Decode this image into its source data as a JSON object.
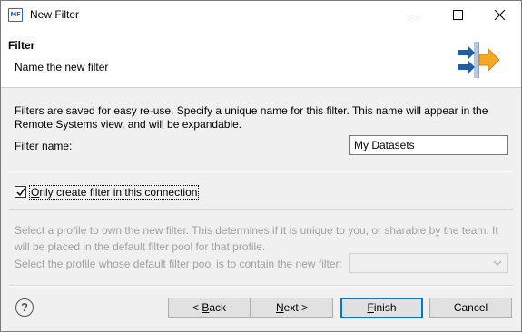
{
  "window": {
    "title": "New Filter",
    "app_icon_text": "MF"
  },
  "banner": {
    "title": "Filter",
    "message": "Name the new filter"
  },
  "form": {
    "description": "Filters are saved for easy re-use. Specify a unique name for this filter. This name will appear in the Remote Systems view, and will be expandable.",
    "filter_name_label_mnemonic": "F",
    "filter_name_label_rest": "ilter name:",
    "filter_name_value": "My Datasets",
    "checkbox_mnemonic": "O",
    "checkbox_label_rest": "nly create filter in this connection",
    "checkbox_checked": true,
    "profile_description": "Select a profile to own the new filter. This determines if it is unique to you, or sharable by the team. It will be placed in the default filter pool for that profile.",
    "profile_label": "Select the profile whose default filter pool is to contain the new filter:",
    "profile_value": ""
  },
  "footer": {
    "help_symbol": "?",
    "back_prefix": "< ",
    "back_mnemonic": "B",
    "back_rest": "ack",
    "next_mnemonic": "N",
    "next_rest": "ext >",
    "finish_mnemonic": "F",
    "finish_rest": "inish",
    "cancel_label": "Cancel"
  },
  "colors": {
    "accent": "#0078d7",
    "arrow_blue": "#1f5fa8",
    "arrow_orange": "#f5a623",
    "disabled_text": "#a0a0a0"
  }
}
